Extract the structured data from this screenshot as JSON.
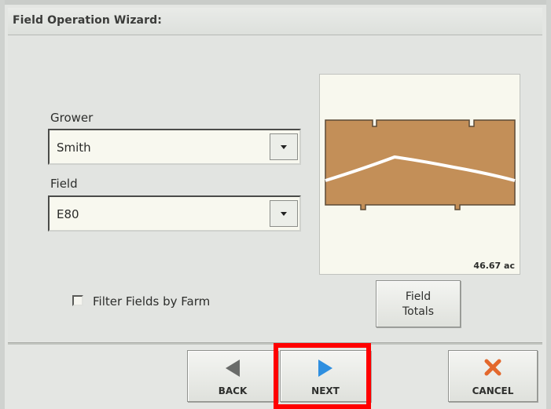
{
  "window": {
    "title": "Field Operation Wizard:"
  },
  "form": {
    "grower": {
      "label": "Grower",
      "value": "Smith"
    },
    "field": {
      "label": "Field",
      "value": "E80"
    },
    "filter_checkbox": {
      "label": "Filter Fields by Farm",
      "checked": false
    }
  },
  "preview": {
    "acreage": "46.67 ac",
    "field_color": "#c38f58",
    "line_color": "#ffffff"
  },
  "buttons": {
    "field_totals_line1": "Field",
    "field_totals_line2": "Totals",
    "back": "BACK",
    "next": "NEXT",
    "cancel": "CANCEL"
  },
  "icons": {
    "back": "back-arrow-icon",
    "next": "next-arrow-icon",
    "cancel": "cancel-x-icon",
    "dropdown": "chevron-down-icon"
  },
  "colors": {
    "back_arrow": "#696b69",
    "next_arrow": "#2f8fe0",
    "cancel_x": "#e3682c",
    "highlight": "#ff0000"
  }
}
